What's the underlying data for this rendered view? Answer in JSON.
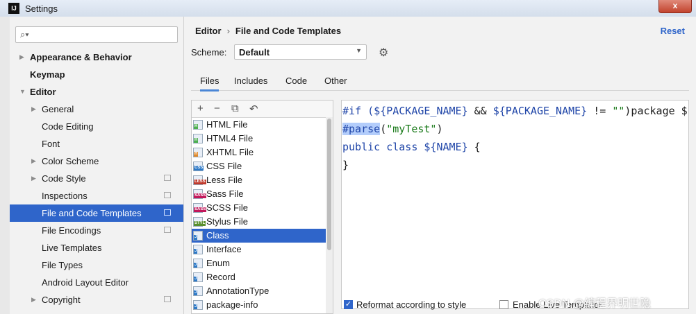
{
  "window": {
    "title": "Settings",
    "app_icon": "IJ",
    "close_label": "x"
  },
  "search": {
    "placeholder": ""
  },
  "sidebar": {
    "items": [
      {
        "label": "Appearance & Behavior",
        "bold": true,
        "arrow": "right",
        "level": 0,
        "project": false,
        "selected": false
      },
      {
        "label": "Keymap",
        "bold": true,
        "arrow": "none",
        "level": 0,
        "project": false,
        "selected": false
      },
      {
        "label": "Editor",
        "bold": true,
        "arrow": "down",
        "level": 0,
        "project": false,
        "selected": false
      },
      {
        "label": "General",
        "bold": false,
        "arrow": "right",
        "level": 1,
        "project": false,
        "selected": false
      },
      {
        "label": "Code Editing",
        "bold": false,
        "arrow": "none",
        "level": 1,
        "project": false,
        "selected": false
      },
      {
        "label": "Font",
        "bold": false,
        "arrow": "none",
        "level": 1,
        "project": false,
        "selected": false
      },
      {
        "label": "Color Scheme",
        "bold": false,
        "arrow": "right",
        "level": 1,
        "project": false,
        "selected": false
      },
      {
        "label": "Code Style",
        "bold": false,
        "arrow": "right",
        "level": 1,
        "project": true,
        "selected": false
      },
      {
        "label": "Inspections",
        "bold": false,
        "arrow": "none",
        "level": 1,
        "project": true,
        "selected": false
      },
      {
        "label": "File and Code Templates",
        "bold": false,
        "arrow": "none",
        "level": 1,
        "project": true,
        "selected": true
      },
      {
        "label": "File Encodings",
        "bold": false,
        "arrow": "none",
        "level": 1,
        "project": true,
        "selected": false
      },
      {
        "label": "Live Templates",
        "bold": false,
        "arrow": "none",
        "level": 1,
        "project": false,
        "selected": false
      },
      {
        "label": "File Types",
        "bold": false,
        "arrow": "none",
        "level": 1,
        "project": false,
        "selected": false
      },
      {
        "label": "Android Layout Editor",
        "bold": false,
        "arrow": "none",
        "level": 1,
        "project": false,
        "selected": false
      },
      {
        "label": "Copyright",
        "bold": false,
        "arrow": "right",
        "level": 1,
        "project": true,
        "selected": false
      }
    ]
  },
  "header": {
    "breadcrumb_parent": "Editor",
    "breadcrumb_sep": "›",
    "breadcrumb_current": "File and Code Templates",
    "reset_label": "Reset"
  },
  "scheme": {
    "label": "Scheme:",
    "value": "Default"
  },
  "tabs": [
    {
      "label": "Files",
      "active": true
    },
    {
      "label": "Includes",
      "active": false
    },
    {
      "label": "Code",
      "active": false
    },
    {
      "label": "Other",
      "active": false
    }
  ],
  "toolbar": {
    "add": "+",
    "remove": "−",
    "copy": "⧉",
    "revert": "↶"
  },
  "templates": [
    {
      "label": "HTML File",
      "badge": "H",
      "badge_color": "#4caf50"
    },
    {
      "label": "HTML4 File",
      "badge": "H",
      "badge_color": "#4caf50"
    },
    {
      "label": "XHTML File",
      "badge": "H",
      "badge_color": "#e08a2c"
    },
    {
      "label": "CSS File",
      "badge": "CSS",
      "badge_color": "#2d79c7"
    },
    {
      "label": "Less File",
      "badge": "LESS",
      "badge_color": "#c0392b"
    },
    {
      "label": "Sass File",
      "badge": "SASS",
      "badge_color": "#c2185b"
    },
    {
      "label": "SCSS File",
      "badge": "SASS",
      "badge_color": "#c2185b"
    },
    {
      "label": "Stylus File",
      "badge": "STYL",
      "badge_color": "#5a8f2e"
    },
    {
      "label": "Class",
      "badge": "J",
      "badge_color": "#2d79c7",
      "selected": true
    },
    {
      "label": "Interface",
      "badge": "J",
      "badge_color": "#2d79c7"
    },
    {
      "label": "Enum",
      "badge": "J",
      "badge_color": "#2d79c7"
    },
    {
      "label": "Record",
      "badge": "J",
      "badge_color": "#2d79c7"
    },
    {
      "label": "AnnotationType",
      "badge": "J",
      "badge_color": "#2d79c7"
    },
    {
      "label": "package-info",
      "badge": "J",
      "badge_color": "#2d79c7"
    }
  ],
  "code": {
    "line1_a": "#if (",
    "line1_b": "${PACKAGE_NAME}",
    "line1_c": " && ",
    "line1_d": "${PACKAGE_NAME}",
    "line1_e": " != ",
    "line1_f": "\"\"",
    "line1_g": ")package ${PACKAGE_NAME};#end",
    "line2_a": "#parse",
    "line2_b": "(",
    "line2_c": "\"myTest\"",
    "line2_d": ")",
    "line3_a": "public class ",
    "line3_b": "${NAME}",
    "line3_c": " {",
    "line4": "}"
  },
  "options": {
    "reformat_label": "Reformat according to style",
    "reformat_checked": true,
    "live_label": "Enable Live Templates",
    "live_checked": false
  },
  "watermark": "CSDN @编程界明世隐",
  "colors": {
    "selection": "#2f65ca",
    "accent": "#4a86d6",
    "keyword": "#1f45a8",
    "string": "#1a7a1a"
  }
}
